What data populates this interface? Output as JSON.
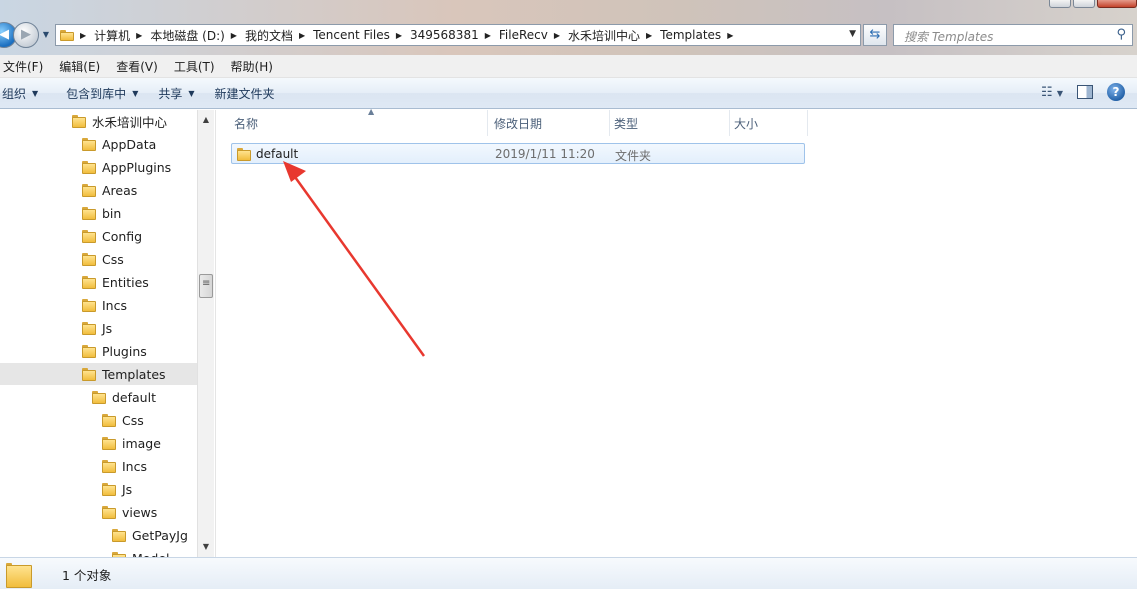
{
  "address": {
    "crumbs": [
      "计算机",
      "本地磁盘 (D:)",
      "我的文档",
      "Tencent Files",
      "349568381",
      "FileRecv",
      "水禾培训中心",
      "Templates"
    ],
    "search_placeholder": "搜索 Templates"
  },
  "menu": [
    "文件(F)",
    "编辑(E)",
    "查看(V)",
    "工具(T)",
    "帮助(H)"
  ],
  "commands": {
    "organize": "组织",
    "include_library": "包含到库中",
    "share": "共享",
    "new_folder": "新建文件夹"
  },
  "nav_tree": [
    {
      "label": "水禾培训中心",
      "level": 0
    },
    {
      "label": "AppData",
      "level": 1
    },
    {
      "label": "AppPlugins",
      "level": 1
    },
    {
      "label": "Areas",
      "level": 1
    },
    {
      "label": "bin",
      "level": 1
    },
    {
      "label": "Config",
      "level": 1
    },
    {
      "label": "Css",
      "level": 1
    },
    {
      "label": "Entities",
      "level": 1
    },
    {
      "label": "Incs",
      "level": 1
    },
    {
      "label": "Js",
      "level": 1
    },
    {
      "label": "Plugins",
      "level": 1
    },
    {
      "label": "Templates",
      "level": 1,
      "selected": true
    },
    {
      "label": "default",
      "level": 2
    },
    {
      "label": "Css",
      "level": 3
    },
    {
      "label": "image",
      "level": 3
    },
    {
      "label": "Incs",
      "level": 3
    },
    {
      "label": "Js",
      "level": 3
    },
    {
      "label": "views",
      "level": 3
    },
    {
      "label": "GetPayJg",
      "level": 4
    },
    {
      "label": "Model",
      "level": 4
    }
  ],
  "columns": {
    "name": "名称",
    "modified": "修改日期",
    "type": "类型",
    "size": "大小"
  },
  "files": [
    {
      "name": "default",
      "modified": "2019/1/11 11:20",
      "type": "文件夹",
      "size": ""
    }
  ],
  "status": {
    "count": "1 个对象"
  },
  "colors": {
    "annotation_arrow": "#e8382f",
    "selection_border": "#9fc3ea"
  }
}
